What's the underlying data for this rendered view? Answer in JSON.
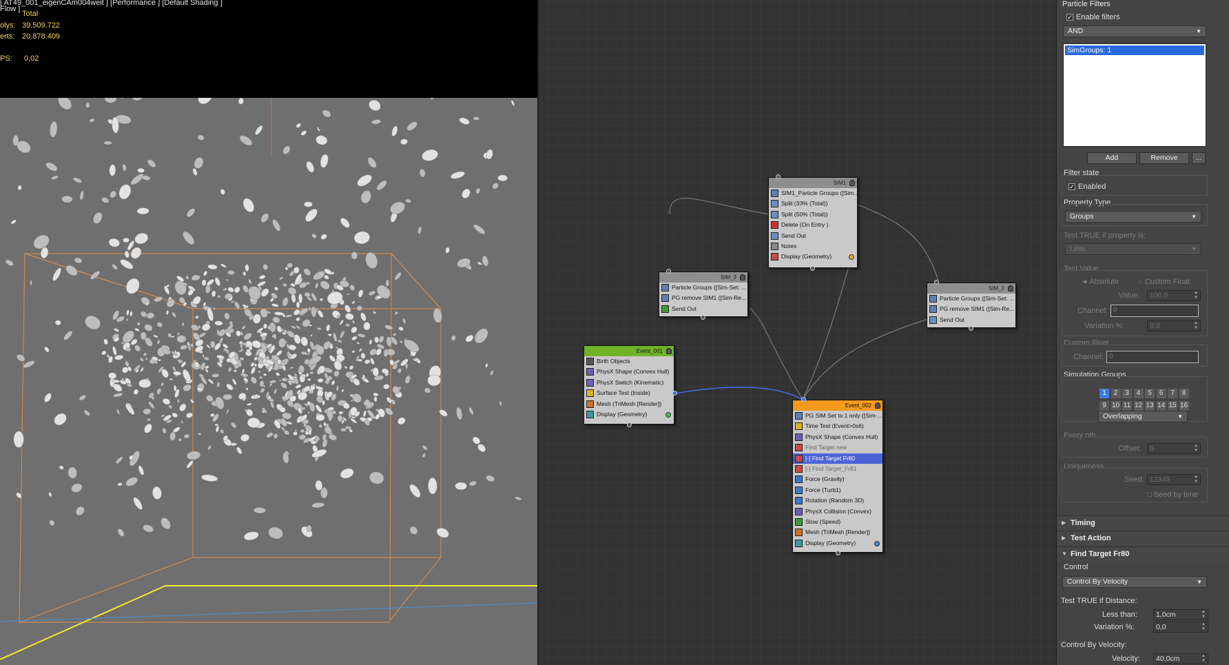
{
  "viewport": {
    "title": "[ AT49_001_eigenCAm004weit ] [Performance ] [Default Shading ]",
    "sub": "Flow ]",
    "total_label": "Total",
    "polys_label": "olys:",
    "polys_value": "39.509.722",
    "verts_label": "erts:",
    "verts_value": "20.878.409",
    "fps_label": "PS:",
    "fps_value": "0,02"
  },
  "nodes": {
    "sim1": {
      "title": "SIM1",
      "ops": [
        "SIM1_Particle Groups ([Sim...",
        "Split (33% (Total))",
        "Split (50% (Total))",
        "Delete (On Entry )",
        "Send Out",
        "Notes",
        "Display (Geometry)"
      ]
    },
    "sim3": {
      "title": "SIM_3",
      "ops": [
        "Particle Groups ([Sim-Set: ...",
        "PG remove SIM1 ([Sim-Re...",
        "Send Out"
      ]
    },
    "sim2": {
      "title": "SIM_2",
      "ops": [
        "Particle Groups ([Sim-Set: ...",
        "PG remove SIM1 ([Sim-Re...",
        "Send Out"
      ]
    },
    "event001": {
      "title": "Event_001",
      "ops": [
        "Birth Objects",
        "PhysX Shape (Convex Hull)",
        "PhysX Switch (Kinematic)",
        "Surface Test (Inside)",
        "Mesh (TriMesh [Render])",
        "Display (Geometry)"
      ]
    },
    "event002": {
      "title": "Event_002",
      "ops": [
        "PG SIM Set to 1 only ([Sim-...",
        "Time Test (Event>0s6)",
        "PhysX Shape (Convex Hull)",
        "Find Target new",
        "[-] Find Target Fr80",
        "[-] Find Target_Fr81",
        "Force (Gravity)",
        "Force (Turb1)",
        "Rotation (Random 3D)",
        "PhysX Collision (Convex)",
        "Slow (Speed)",
        "Mesh (TriMesh [Render])",
        "Display (Geometry)"
      ]
    }
  },
  "panel": {
    "header": "Particle Filters",
    "enable_filters": "Enable filters",
    "logic": "AND",
    "list_item": "SimGroups:  1",
    "add": "Add",
    "remove": "Remove",
    "more": "...",
    "filter_state": "Filter state",
    "enabled": "Enabled",
    "property_type": "Property Type",
    "property_value": "Groups",
    "test_true": "Test TRUE if property is:",
    "test_true_value": "Less",
    "test_value": "Test Value",
    "absolute": "Absolute",
    "custom_float": "Custom Float",
    "value_label": "Value:",
    "value": "100,0",
    "channel_label": "Channel:",
    "channel_value": "0",
    "variation_label": "Variation %:",
    "variation_value": "0,0",
    "custom_float_group": "Custom Float",
    "channel2_label": "Channel:",
    "channel2_value": "0",
    "sim_groups": "Simulation Groups",
    "groups_row1": [
      "1",
      "2",
      "3",
      "4",
      "5",
      "6",
      "7",
      "8"
    ],
    "groups_row2": [
      "9",
      "10",
      "11",
      "12",
      "13",
      "14",
      "15",
      "16"
    ],
    "overlap": "Overlapping",
    "every_nth": "Every nth",
    "offset_label": "Offset:",
    "offset_value": "0",
    "uniqueness": "Uniqueness",
    "seed_label": "Seed:",
    "seed_value": "12345",
    "seed_by_time": "Seed by time",
    "rollout_timing": "Timing",
    "rollout_test_action": "Test Action",
    "rollout_find_target": "Find Target Fr80",
    "control": "Control",
    "control_value": "Control By Velocity",
    "test_dist": "Test TRUE if Distance:",
    "less_than_label": "Less than:",
    "less_than_value": "1,0cm",
    "variation2_label": "Variation %:",
    "variation2_value": "0,0",
    "ctrl_vel": "Control By Velocity:",
    "velocity_label": "Velocity:",
    "velocity_value": "40,0cm"
  }
}
